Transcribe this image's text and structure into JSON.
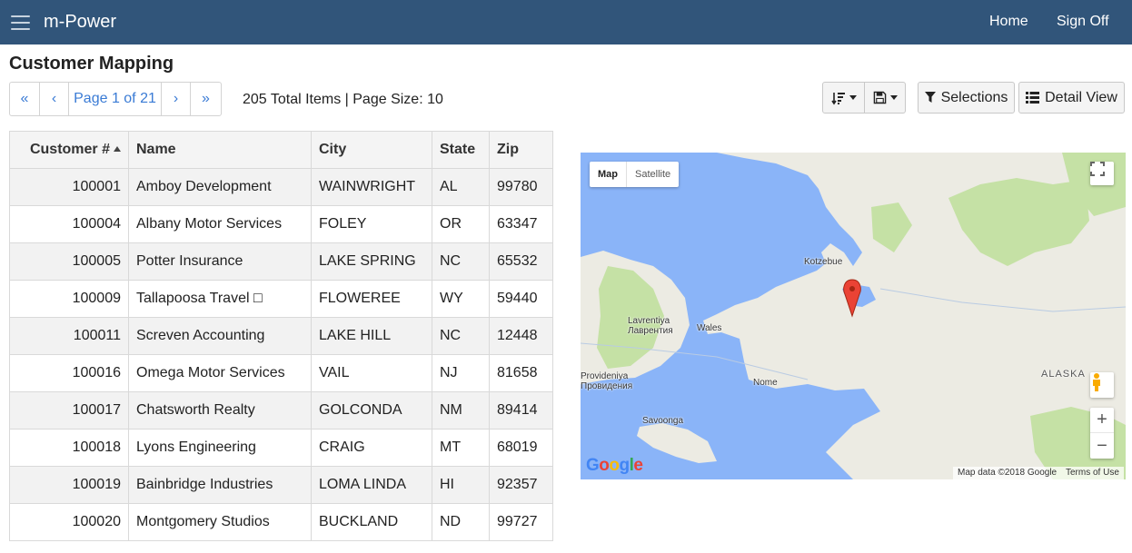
{
  "app": {
    "brand": "m-Power"
  },
  "nav": {
    "home": "Home",
    "signoff": "Sign Off"
  },
  "page": {
    "title": "Customer Mapping"
  },
  "pager": {
    "first": "«",
    "prev": "‹",
    "page_label": "Page 1 of 21",
    "next": "›",
    "last": "»",
    "summary": "205 Total Items | Page Size: 10"
  },
  "toolbar": {
    "selections_label": "Selections",
    "detail_view_label": "Detail View"
  },
  "icons": {
    "menu": "hamburger-icon",
    "sort": "sort-amount-icon",
    "save": "floppy-disk-icon",
    "filter": "filter-icon",
    "list": "list-icon"
  },
  "table": {
    "columns": [
      "Customer #",
      "Name",
      "City",
      "State",
      "Zip"
    ],
    "rows": [
      [
        "100001",
        "Amboy Development",
        "WAINWRIGHT",
        "AL",
        "99780"
      ],
      [
        "100004",
        "Albany Motor Services",
        "FOLEY",
        "OR",
        "63347"
      ],
      [
        "100005",
        "Potter Insurance",
        "LAKE SPRING",
        "NC",
        "65532"
      ],
      [
        "100009",
        "Tallapoosa Travel □",
        "FLOWEREE",
        "WY",
        "59440"
      ],
      [
        "100011",
        "Screven Accounting",
        "LAKE HILL",
        "NC",
        "12448"
      ],
      [
        "100016",
        "Omega Motor Services",
        "VAIL",
        "NJ",
        "81658"
      ],
      [
        "100017",
        "Chatsworth Realty",
        "GOLCONDA",
        "NM",
        "89414"
      ],
      [
        "100018",
        "Lyons Engineering",
        "CRAIG",
        "MT",
        "68019"
      ],
      [
        "100019",
        "Bainbridge Industries",
        "LOMA LINDA",
        "HI",
        "92357"
      ],
      [
        "100020",
        "Montgomery Studios",
        "BUCKLAND",
        "ND",
        "99727"
      ]
    ]
  },
  "map": {
    "type_map": "Map",
    "type_satellite": "Satellite",
    "labels": {
      "kotzebue": "Kotzebue",
      "lavrentiya": "Lavrentiya\nЛаврентия",
      "wales": "Wales",
      "provideniya": "Provideniya\nПровидения",
      "nome": "Nome",
      "savoonga": "Savoonga",
      "alaska": "ALASKA"
    },
    "zoom_in": "+",
    "zoom_out": "−",
    "logo": "Google",
    "attribution": "Map data ©2018 Google",
    "terms": "Terms of Use",
    "colors": {
      "water": "#8ab4f8",
      "land": "#ecebe3",
      "park": "#c5e1a5",
      "marker": "#ea4335"
    }
  }
}
